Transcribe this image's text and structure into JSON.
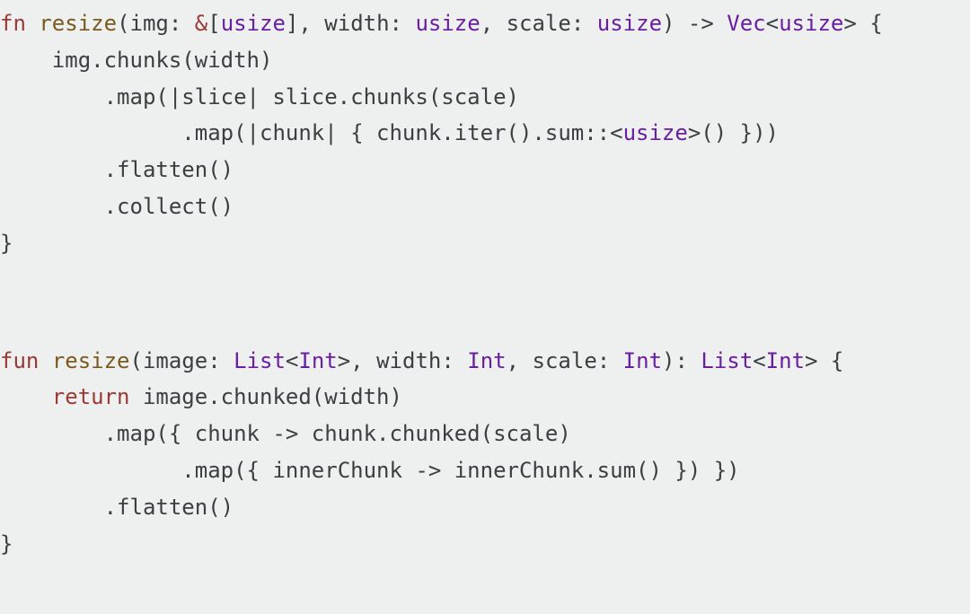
{
  "rust": {
    "kw_fn": "fn",
    "name": "resize",
    "p1_name": "img",
    "p1_type_ref": "&",
    "p1_type_open": "[",
    "p1_type": "usize",
    "p1_type_close": "]",
    "p2_name": "width",
    "p2_type": "usize",
    "p3_name": "scale",
    "p3_type": "usize",
    "arrow": "->",
    "ret_type": "Vec",
    "ret_inner": "usize",
    "l2": "img.chunks(width)",
    "l3a": ".map(|slice| slice.chunks(scale)",
    "l4a": ".map(|chunk| { chunk.iter().sum::",
    "l4b": "usize",
    "l4c": "() }))",
    "l5": ".flatten()",
    "l6": ".collect()",
    "close": "}"
  },
  "kotlin": {
    "kw_fun": "fun",
    "name": "resize",
    "p1_name": "image",
    "p1_type": "List",
    "p1_inner": "Int",
    "p2_name": "width",
    "p2_type": "Int",
    "p3_name": "scale",
    "p3_type": "Int",
    "ret_type": "List",
    "ret_inner": "Int",
    "kw_return": "return",
    "l2b": " image.chunked(width)",
    "l3": ".map({ chunk -> chunk.chunked(scale)",
    "l4": ".map({ innerChunk -> innerChunk.sum() }) })",
    "l5": ".flatten()",
    "close": "}"
  }
}
